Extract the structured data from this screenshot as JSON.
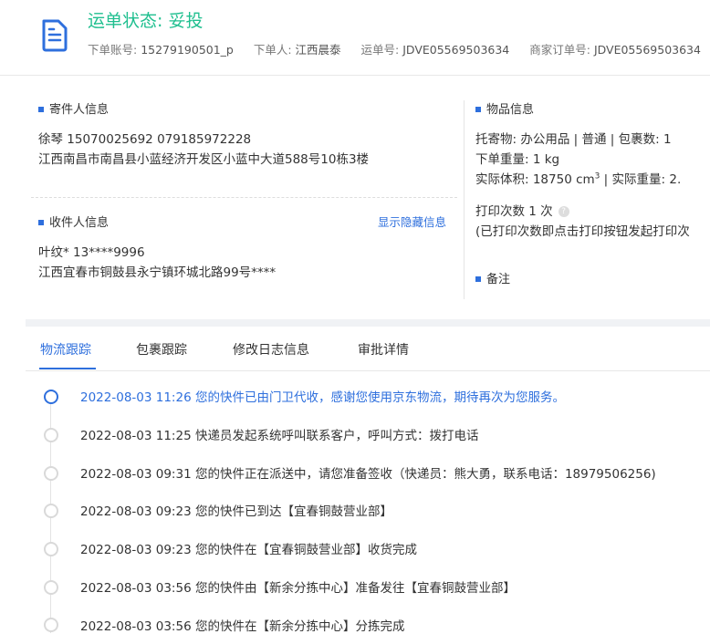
{
  "header": {
    "status": "运单状态: 妥投",
    "account_label": "下单账号:",
    "account": "15279190501_p",
    "orderer_label": "下单人:",
    "orderer": "江西晨泰",
    "waybill_label": "运单号:",
    "waybill": "JDVE05569503634",
    "merchant_order_label": "商家订单号:",
    "merchant_order": "JDVE05569503634"
  },
  "sender": {
    "title": "寄件人信息",
    "name_phones": "徐琴   15070025692   079185972228",
    "address": "江西南昌市南昌县小蓝经济开发区小蓝中大道588号10栋3楼"
  },
  "receiver": {
    "title": "收件人信息",
    "toggle_link": "显示隐藏信息",
    "name_phone": "叶纹*   13****9996",
    "address": "江西宜春市铜鼓县永宁镇环城北路99号****"
  },
  "goods": {
    "title": "物品信息",
    "line1": "托寄物: 办公用品 | 普通 | 包裹数: 1",
    "weight": "下单重量:  1 kg",
    "volume_prefix": "实际体积:   18750 cm",
    "volume_sup": "3",
    "volume_suffix": " | 实际重量:  2.",
    "print_label": "打印次数   1 次",
    "help_glyph": "?",
    "print_note": "(已打印次数即点击打印按钮发起打印次"
  },
  "remark": {
    "title": "备注"
  },
  "tabs": [
    {
      "label": "物流跟踪"
    },
    {
      "label": "包裹跟踪"
    },
    {
      "label": "修改日志信息"
    },
    {
      "label": "审批详情"
    }
  ],
  "timeline": [
    {
      "text": "2022-08-03 11:26 您的快件已由门卫代收，感谢您使用京东物流，期待再次为您服务。"
    },
    {
      "text": "2022-08-03 11:25 快递员发起系统呼叫联系客户，呼叫方式：拨打电话"
    },
    {
      "text": "2022-08-03 09:31 您的快件正在派送中，请您准备签收（快递员：熊大勇，联系电话：18979506256)"
    },
    {
      "text": "2022-08-03 09:23 您的快件已到达【宜春铜鼓营业部】"
    },
    {
      "text": "2022-08-03 09:23 您的快件在【宜春铜鼓营业部】收货完成"
    },
    {
      "text": "2022-08-03 03:56 您的快件由【新余分拣中心】准备发往【宜春铜鼓营业部】"
    },
    {
      "text": "2022-08-03 03:56 您的快件在【新余分拣中心】分拣完成"
    }
  ],
  "colors": {
    "accent": "#2e6fdd",
    "status": "#1fbf8f"
  }
}
